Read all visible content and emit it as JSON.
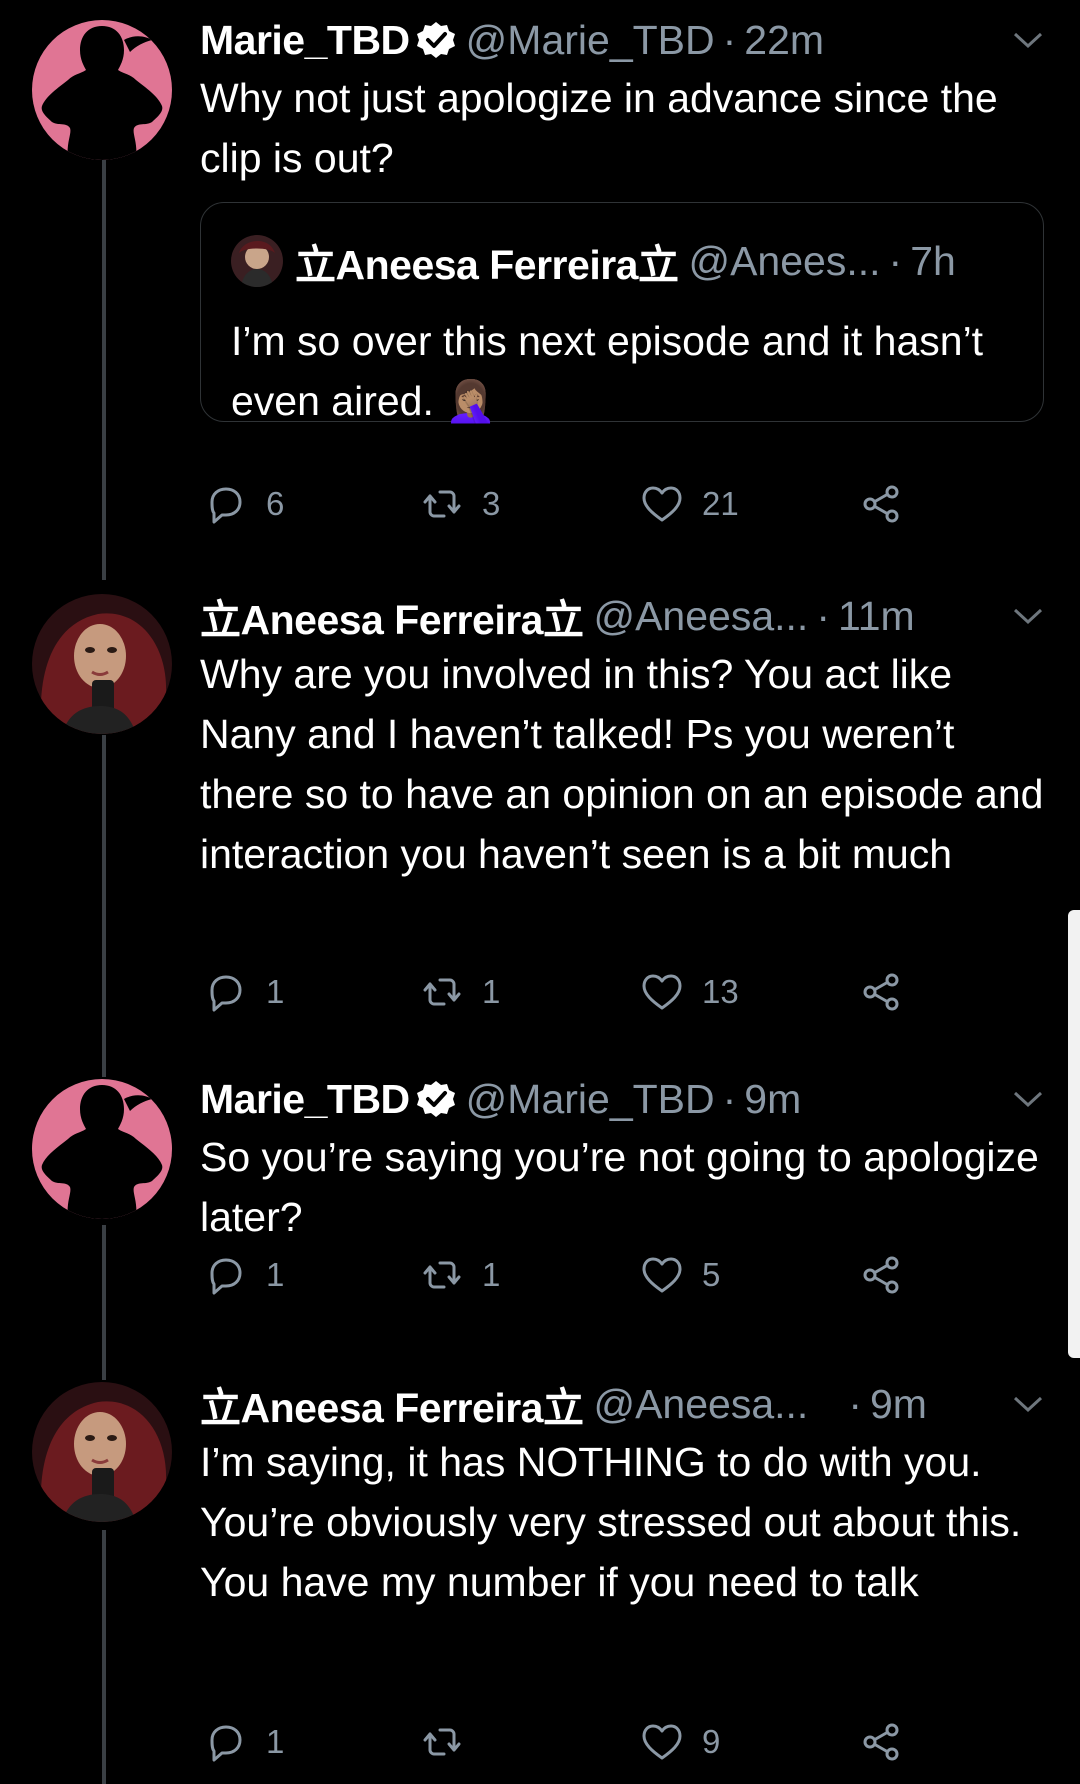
{
  "tweets": [
    {
      "name": "Marie_TBD",
      "verified": true,
      "handle": "@Marie_TBD",
      "time": "22m",
      "text": "Why not just apologize in advance since the clip is out?",
      "quote": {
        "name": "立Aneesa Ferreira立",
        "handle": "@Anees...",
        "time": "7h",
        "text": "I’m so over this next episode and it hasn’t even aired. 🤦🏽‍♀️"
      },
      "replies": "6",
      "retweets": "3",
      "likes": "21"
    },
    {
      "name": "立Aneesa Ferreira立",
      "verified": false,
      "handle": "@Aneesa...",
      "time": "11m",
      "text": "Why are you involved in this? You act like Nany and I haven’t talked! Ps you weren’t there so to have an opinion on an episode and interaction you haven’t seen is a bit much",
      "replies": "1",
      "retweets": "1",
      "likes": "13"
    },
    {
      "name": "Marie_TBD",
      "verified": true,
      "handle": "@Marie_TBD",
      "time": "9m",
      "text": "So you’re saying you’re not going to apologize later?",
      "replies": "1",
      "retweets": "1",
      "likes": "5"
    },
    {
      "name": "立Aneesa Ferreira立",
      "verified": false,
      "handle": "@Aneesa...",
      "time": "9m",
      "text": "I’m saying, it has NOTHING to do with you. You’re obviously very stressed out about this. You have my number if you need to talk",
      "replies": "1",
      "retweets": "",
      "likes": "9"
    }
  ],
  "icons": {
    "verified": "verified-badge-icon",
    "caret": "chevron-down-icon",
    "reply": "reply-icon",
    "retweet": "retweet-icon",
    "like": "heart-icon",
    "share": "share-icon"
  },
  "colors": {
    "background": "#000000",
    "secondary_text": "#8b98a5",
    "marie_avatar_bg": "#e07594"
  }
}
